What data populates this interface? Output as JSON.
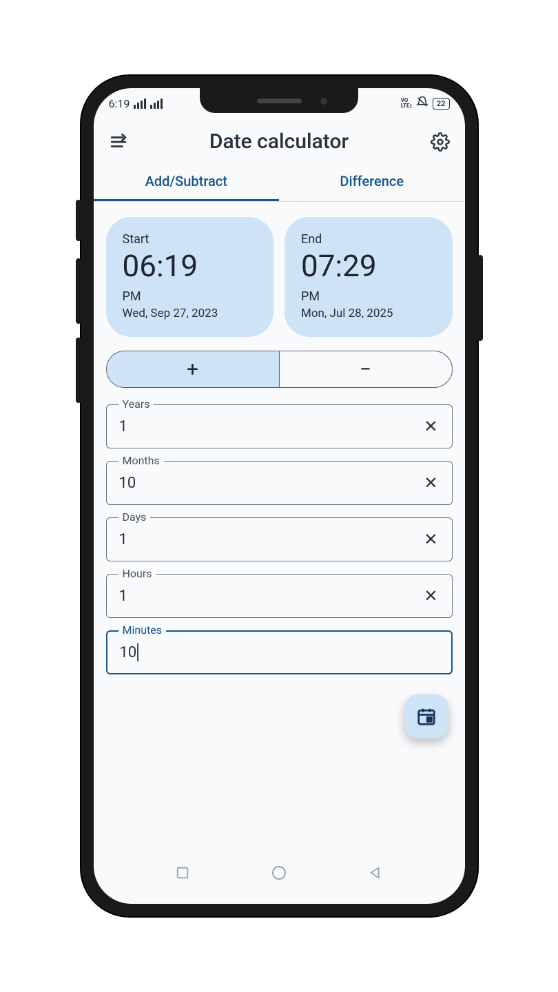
{
  "statusbar": {
    "time": "6:19",
    "volte": "VO LTE2",
    "battery": "22"
  },
  "header": {
    "title": "Date calculator"
  },
  "tabs": {
    "add_subtract": "Add/Subtract",
    "difference": "Difference",
    "active": "add_subtract"
  },
  "start": {
    "label": "Start",
    "time": "06:19",
    "ampm": "PM",
    "date": "Wed, Sep 27, 2023"
  },
  "end": {
    "label": "End",
    "time": "07:29",
    "ampm": "PM",
    "date": "Mon, Jul 28, 2025"
  },
  "op": {
    "plus": "+",
    "minus": "−",
    "active": "plus"
  },
  "fields": {
    "years": {
      "label": "Years",
      "value": "1"
    },
    "months": {
      "label": "Months",
      "value": "10"
    },
    "days": {
      "label": "Days",
      "value": "1"
    },
    "hours": {
      "label": "Hours",
      "value": "1"
    },
    "minutes": {
      "label": "Minutes",
      "value": "10"
    }
  }
}
